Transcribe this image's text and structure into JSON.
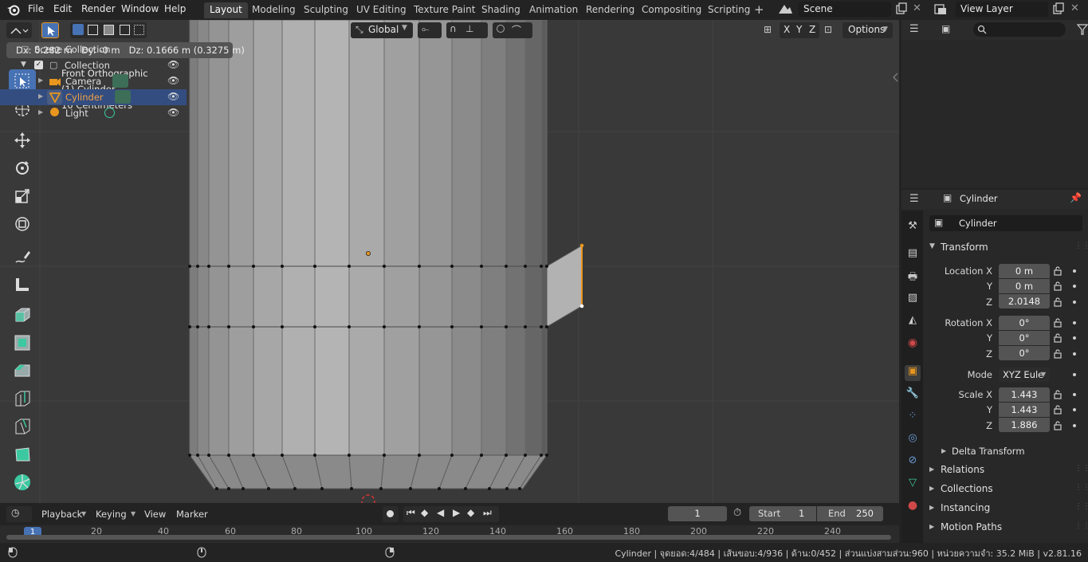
{
  "menu": [
    "File",
    "Edit",
    "Render",
    "Window",
    "Help"
  ],
  "workspaces": [
    "Layout",
    "Modeling",
    "Sculpting",
    "UV Editing",
    "Texture Paint",
    "Shading",
    "Animation",
    "Rendering",
    "Compositing",
    "Scripting"
  ],
  "active_workspace": "Layout",
  "scene_name": "Scene",
  "view_layer": "View Layer",
  "viewport": {
    "transform_orientation": "Global",
    "options_label": "Options",
    "axes": [
      "X",
      "Y",
      "Z"
    ],
    "delta_readout": "Dx: 0.282 m   Dy: -0 m   Dz: 0.1666 m (0.3275 m)",
    "overlay": [
      "Front Orthographic",
      "(1) Cylinder",
      "10 Centimeters"
    ]
  },
  "outliner": {
    "root": "Scene Collection",
    "collection": "Collection",
    "items": [
      "Camera",
      "Cylinder",
      "Light"
    ],
    "selected": "Cylinder"
  },
  "properties": {
    "object_name": "Cylinder",
    "data_name": "Cylinder",
    "transform_title": "Transform",
    "location_label": "Location X",
    "rotation_label": "Rotation X",
    "scale_label": "Scale X",
    "y_label": "Y",
    "z_label": "Z",
    "location": [
      "0 m",
      "0 m",
      "2.0148"
    ],
    "rotation": [
      "0°",
      "0°",
      "0°"
    ],
    "mode_label": "Mode",
    "mode_value": "XYZ Eule",
    "scale": [
      "1.443",
      "1.443",
      "1.886"
    ],
    "delta_transform": "Delta Transform",
    "panels": [
      "Relations",
      "Collections",
      "Instancing",
      "Motion Paths"
    ]
  },
  "timeline": {
    "menus": [
      "Playback",
      "Keying",
      "View",
      "Marker"
    ],
    "current_frame": "1",
    "start_label": "Start",
    "start_value": "1",
    "end_label": "End",
    "end_value": "250",
    "ruler": [
      "1",
      "20",
      "40",
      "60",
      "80",
      "100",
      "120",
      "140",
      "160",
      "180",
      "200",
      "220",
      "240"
    ]
  },
  "status": "Cylinder | จุดยอด:4/484 | เส้นขอบ:4/936 | ด้าน:0/452 | ส่วนแบ่งสามส่วน:960 | หน่วยความจำ: 35.2 MiB | v2.81.16",
  "colors": {
    "accent": "#4772b3",
    "selected_row": "#334d80",
    "edge_selected": "#e8961e"
  }
}
